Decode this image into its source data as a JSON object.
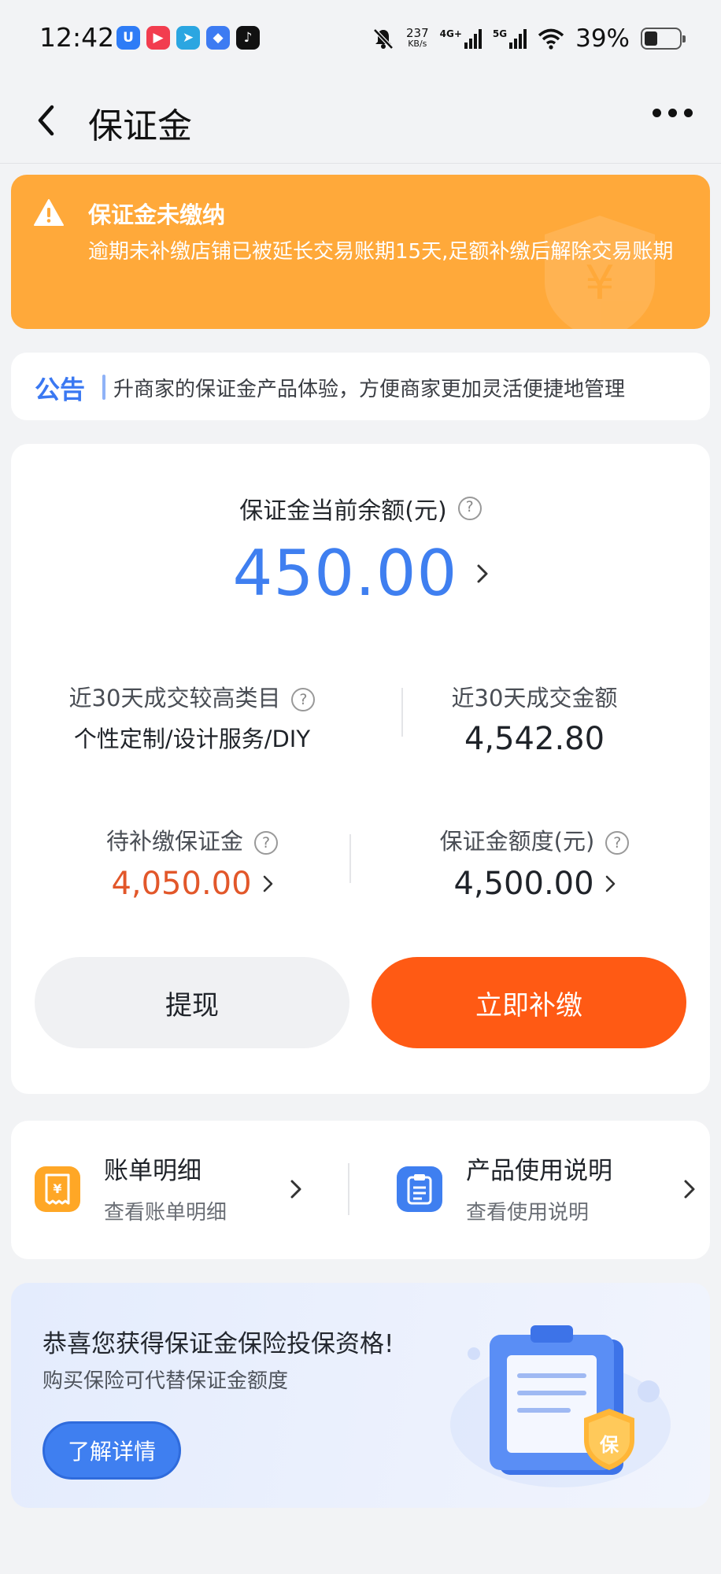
{
  "status_bar": {
    "time": "12:42",
    "net_speed": "237",
    "net_speed_unit": "KB/s",
    "net1": "4G+",
    "net2": "5G",
    "battery": "39%",
    "apps": [
      {
        "icon": "app-icon-blue",
        "color": "#2e7cf6",
        "glyph": "U"
      },
      {
        "icon": "app-icon-red",
        "color": "#f23d4f",
        "glyph": "▶"
      },
      {
        "icon": "telegram-icon",
        "color": "#2ba6e1",
        "glyph": "➤"
      },
      {
        "icon": "app-icon-tile",
        "color": "#3d7bf2",
        "glyph": "◆"
      },
      {
        "icon": "tiktok-icon",
        "color": "#111111",
        "glyph": "♪"
      }
    ]
  },
  "nav": {
    "title": "保证金"
  },
  "alert": {
    "title": "保证金未缴纳",
    "text": "逾期未补缴店铺已被延长交易账期15天,足额补缴后解除交易账期",
    "color": "#ffa93a"
  },
  "notice": {
    "label": "公告",
    "text": "升商家的保证金产品体验，方便商家更加灵活便捷地管理"
  },
  "balance": {
    "label": "保证金当前余额(元)",
    "value": "450.00",
    "help_icon": "question-icon"
  },
  "stats": {
    "top_category_label": "近30天成交较高类目",
    "top_category_value": "个性定制/设计服务/DIY",
    "gmv_label": "近30天成交金额",
    "gmv_value": "4,542.80",
    "pending_label": "待补缴保证金",
    "pending_value": "4,050.00",
    "limit_label": "保证金额度(元)",
    "limit_value": "4,500.00"
  },
  "actions": {
    "withdraw": "提现",
    "pay_now": "立即补缴",
    "pay_color": "#ff5a14"
  },
  "links": [
    {
      "title": "账单明细",
      "sub": "查看账单明细",
      "icon": "yuan-receipt-icon",
      "color": "#ffa726"
    },
    {
      "title": "产品使用说明",
      "sub": "查看使用说明",
      "icon": "clipboard-icon",
      "color": "#3f7ff0"
    }
  ],
  "promo": {
    "title": "恭喜您获得保证金保险投保资格!",
    "sub": "购买保险可代替保证金额度",
    "button": "了解详情",
    "badge_glyph": "保"
  }
}
